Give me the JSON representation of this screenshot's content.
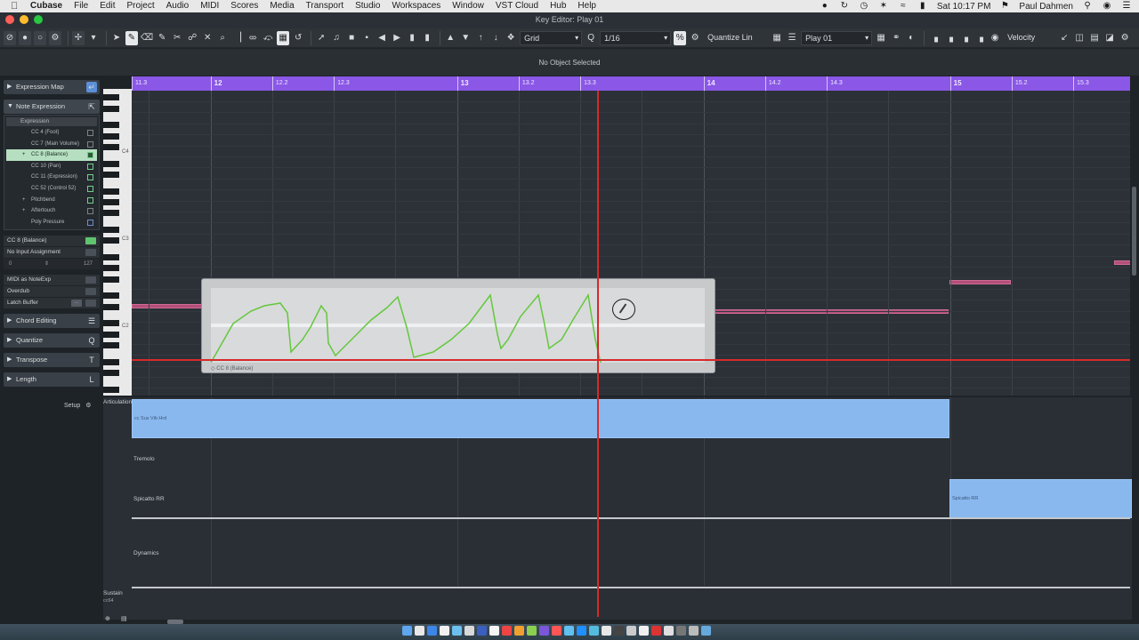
{
  "menubar": {
    "apple": "",
    "items": [
      "Cubase",
      "File",
      "Edit",
      "Project",
      "Audio",
      "MIDI",
      "Scores",
      "Media",
      "Transport",
      "Studio",
      "Workspaces",
      "Window",
      "VST Cloud",
      "Hub",
      "Help"
    ],
    "clock": "Sat 10:17 PM",
    "user": "Paul Dahmen"
  },
  "window": {
    "title": "Key Editor: Play 01"
  },
  "toolbar": {
    "snap_type": "Grid",
    "quantize_value": "1/16",
    "quantize_mode": "Quantize Lin",
    "track": "Play 01",
    "velocity": "Velocity"
  },
  "infoline": {
    "text": "No Object Selected"
  },
  "inspector": {
    "expression_map": "Expression Map",
    "note_expression": "Note Expression",
    "ne_header": "Expression",
    "ne_rows": [
      {
        "label": "CC 4 (Foot)",
        "bullet": "",
        "check": "plain"
      },
      {
        "label": "CC 7 (Main Volume)",
        "bullet": "",
        "check": "plain"
      },
      {
        "label": "CC 8 (Balance)",
        "bullet": "+",
        "check": "green"
      },
      {
        "label": "CC 10 (Pan)",
        "bullet": "",
        "check": "green"
      },
      {
        "label": "CC 11 (Expression)",
        "bullet": "",
        "check": "green"
      },
      {
        "label": "CC 52 (Control 52)",
        "bullet": "",
        "check": "green"
      },
      {
        "label": "Pitchbend",
        "bullet": "+",
        "check": "green"
      },
      {
        "label": "Aftertouch",
        "bullet": "+",
        "check": "plain"
      },
      {
        "label": "Poly Pressure",
        "bullet": "",
        "check": "blue"
      }
    ],
    "cc_selected": "CC 8 (Balance)",
    "input_assignment": "No Input Assignment",
    "range_lo": "0",
    "range_hi": "127",
    "midi_as_noteexp": "MIDI as NoteExp",
    "overdub": "Overdub",
    "latch_buffer": "Latch Buffer",
    "chord_editing": "Chord Editing",
    "quantize": "Quantize",
    "transpose": "Transpose",
    "length": "Length",
    "setup": "Setup"
  },
  "keys": {
    "c4": "C4",
    "c3": "C3",
    "c2": "C2"
  },
  "ruler": {
    "ticks": [
      {
        "label": "11.3",
        "bar": 11.5
      },
      {
        "label": "12",
        "bar": 12
      },
      {
        "label": "12.2",
        "bar": 12.25
      },
      {
        "label": "12.3",
        "bar": 12.5
      },
      {
        "label": "13",
        "bar": 13
      },
      {
        "label": "13.2",
        "bar": 13.25
      },
      {
        "label": "13.3",
        "bar": 13.5
      },
      {
        "label": "14",
        "bar": 14
      },
      {
        "label": "14.2",
        "bar": 14.25
      },
      {
        "label": "14.3",
        "bar": 14.5
      },
      {
        "label": "15",
        "bar": 15
      },
      {
        "label": "15.2",
        "bar": 15.25
      },
      {
        "label": "15.3",
        "bar": 15.5
      }
    ]
  },
  "ne_editor": {
    "label": "CC 8 (Balance)"
  },
  "lanes": {
    "articulations_label": "Articulations",
    "rows": [
      "Tremolo",
      "Spicatto RR",
      "Dynamics"
    ],
    "blocks": [
      {
        "label": "cc Sus Vib Hrd"
      },
      {
        "label": "Spicatto RR"
      }
    ],
    "sustain": "Sustain",
    "sustain_sub": "cc64"
  }
}
